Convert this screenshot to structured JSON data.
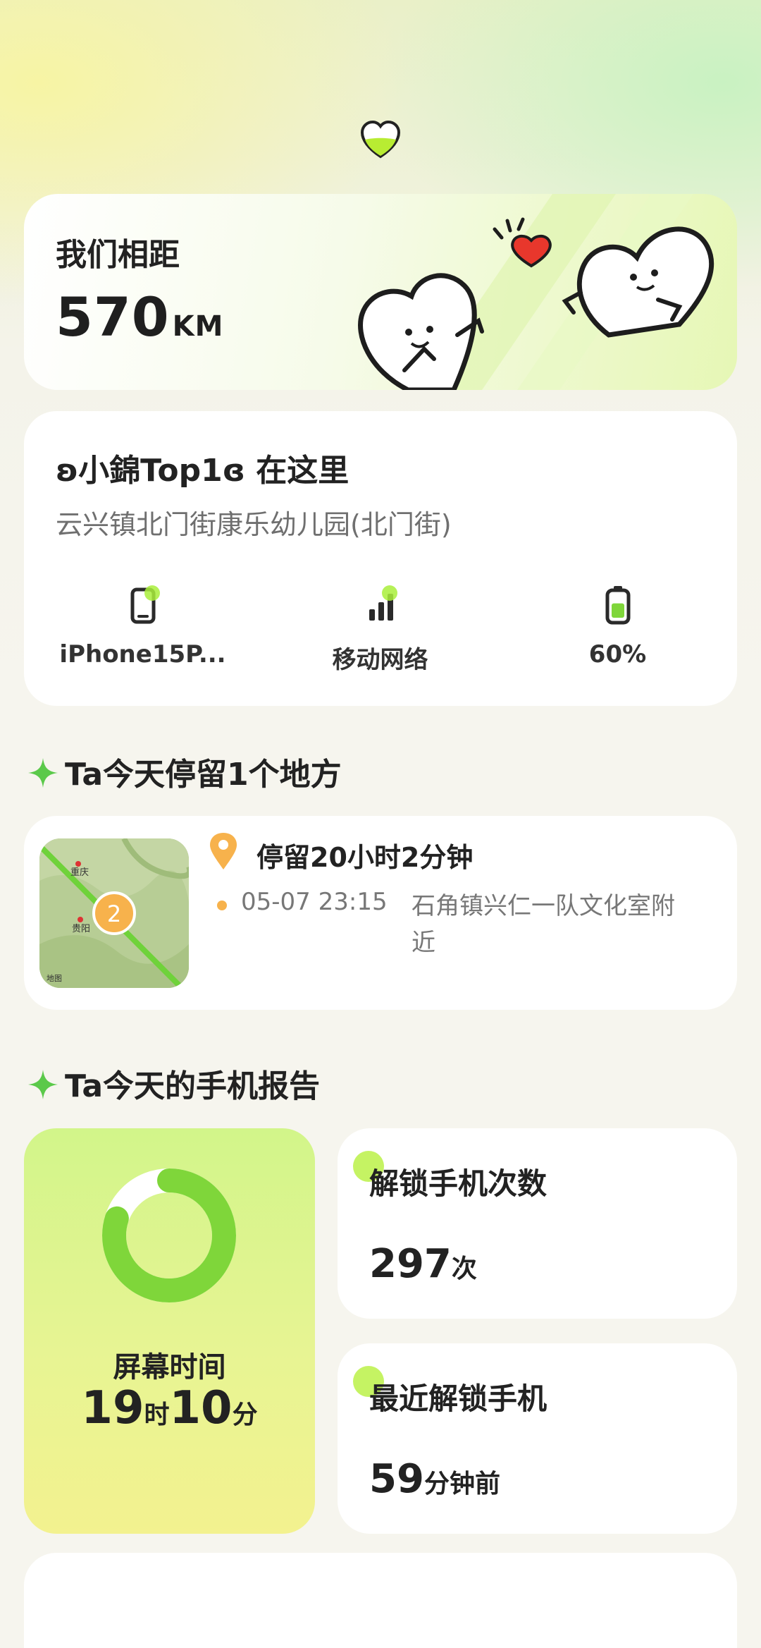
{
  "distance": {
    "label": "我们相距",
    "value": "570",
    "unit": "KM"
  },
  "location": {
    "title": "ʚ小錦Top1ɞ 在这里",
    "address": "云兴镇北门街康乐幼儿园(北门街)",
    "stats": [
      {
        "icon": "phone-icon",
        "label": "iPhone15P..."
      },
      {
        "icon": "signal-icon",
        "label": "移动网络"
      },
      {
        "icon": "battery-icon",
        "label": "60%"
      }
    ],
    "battery_level": 0.6
  },
  "places_section": {
    "title": "Ta今天停留1个地方"
  },
  "stay": {
    "duration": "停留20小时2分钟",
    "time": "05-07 23:15",
    "place": "石角镇兴仁一队文化室附近",
    "map": {
      "city1": "重庆",
      "city2": "贵阳",
      "cluster_count": "2",
      "watermark": "地图"
    }
  },
  "report_section": {
    "title": "Ta今天的手机报告"
  },
  "screen_time": {
    "label": "屏幕时间",
    "hours": "19",
    "hours_unit": "时",
    "minutes": "10",
    "minutes_unit": "分",
    "ring_fraction": 0.8
  },
  "unlock_count": {
    "label": "解锁手机次数",
    "value": "297",
    "unit": "次"
  },
  "last_unlock": {
    "label": "最近解锁手机",
    "value": "59",
    "unit": "分钟前"
  },
  "colors": {
    "accent_green": "#7fd63a",
    "pin_orange": "#f7b24c",
    "heart_red": "#e8372c"
  }
}
